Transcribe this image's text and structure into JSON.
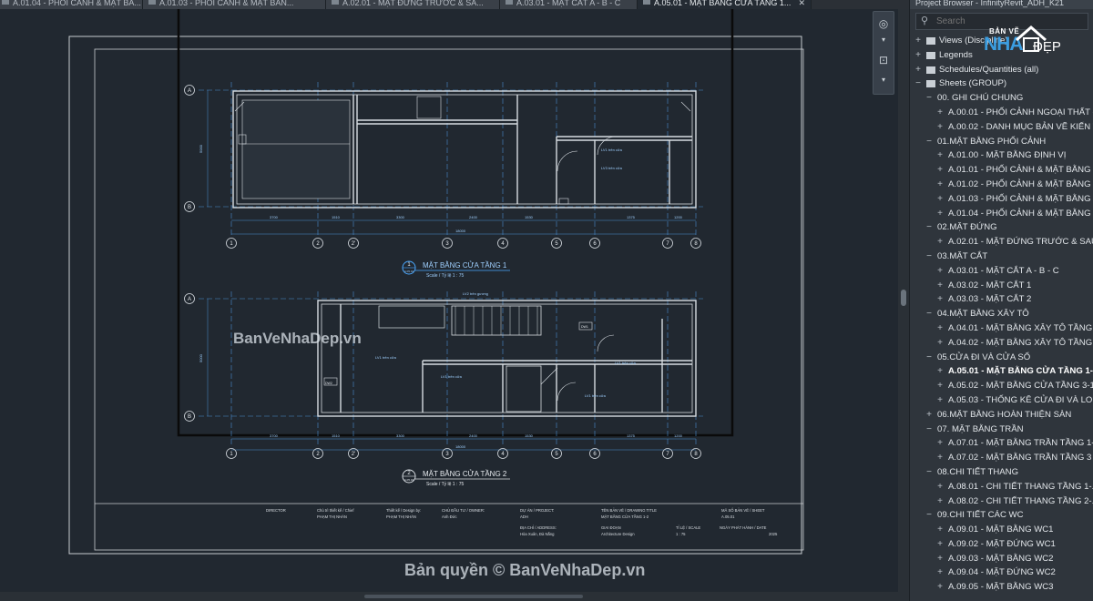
{
  "tabs": [
    {
      "label": "A.01.04 - PHỐI CẢNH & MẶT BẰ...",
      "active": false
    },
    {
      "label": "A.01.03 - PHỐI CẢNH & MẶT BẰN...",
      "active": false
    },
    {
      "label": "A.02.01 - MẶT ĐỨNG TRƯỚC & SA...",
      "active": false
    },
    {
      "label": "A.03.01 - MẶT CẮT A - B - C",
      "active": false
    },
    {
      "label": "A.05.01 - MẶT BẰNG CỬA TẦNG 1...",
      "active": true
    }
  ],
  "tab_close": "✕",
  "project_browser": {
    "title": "Project Browser - InfinityRevit_ADH_K21",
    "search_placeholder": "Search",
    "nodes": [
      {
        "toggle": "+",
        "icon": "views-icon",
        "label": "Views (Discipline)",
        "level": 0
      },
      {
        "toggle": "+",
        "icon": "legends-icon",
        "label": "Legends",
        "level": 0
      },
      {
        "toggle": "+",
        "icon": "schedules-icon",
        "label": "Schedules/Quantities (all)",
        "level": 0
      },
      {
        "toggle": "−",
        "icon": "sheets-icon",
        "label": "Sheets (GROUP)",
        "level": 0
      },
      {
        "toggle": "−",
        "label": "00. GHI CHÚ CHUNG",
        "level": 1
      },
      {
        "toggle": "+",
        "label": "A.00.01 - PHỐI CẢNH NGOẠI THẤT - ...",
        "level": 2
      },
      {
        "toggle": "+",
        "label": "A.00.02 - DANH MỤC BẢN VẼ KIẾN TRÚC",
        "level": 2
      },
      {
        "toggle": "−",
        "label": "01.MẶT BẰNG PHỐI CẢNH",
        "level": 1
      },
      {
        "toggle": "+",
        "label": "A.01.00 - MẶT BẰNG ĐỊNH VỊ",
        "level": 2
      },
      {
        "toggle": "+",
        "label": "A.01.01 - PHỐI CẢNH & MẶT BẰNG ...",
        "level": 2
      },
      {
        "toggle": "+",
        "label": "A.01.02 - PHỐI CẢNH & MẶT BẰNG ...",
        "level": 2
      },
      {
        "toggle": "+",
        "label": "A.01.03 - PHỐI CẢNH & MẶT BẰNG ...",
        "level": 2
      },
      {
        "toggle": "+",
        "label": "A.01.04 - PHỐI CẢNH & MẶT BẰNG ...",
        "level": 2
      },
      {
        "toggle": "−",
        "label": "02.MẶT ĐỨNG",
        "level": 1
      },
      {
        "toggle": "+",
        "label": "A.02.01 - MẶT ĐỨNG TRƯỚC & SAU",
        "level": 2
      },
      {
        "toggle": "−",
        "label": "03.MẶT CẮT",
        "level": 1
      },
      {
        "toggle": "+",
        "label": "A.03.01 - MẶT CẮT A - B - C",
        "level": 2
      },
      {
        "toggle": "+",
        "label": "A.03.02 - MẶT CẮT 1",
        "level": 2
      },
      {
        "toggle": "+",
        "label": "A.03.03 - MẶT CẮT 2",
        "level": 2
      },
      {
        "toggle": "−",
        "label": "04.MẶT BẰNG XÂY TÔ",
        "level": 1
      },
      {
        "toggle": "+",
        "label": "A.04.01 - MẶT BẰNG XÂY TÔ TẦNG ...",
        "level": 2
      },
      {
        "toggle": "+",
        "label": "A.04.02 - MẶT BẰNG XÂY TÔ TẦNG ...",
        "level": 2
      },
      {
        "toggle": "−",
        "label": "05.CỬA ĐI VÀ CỬA SỔ",
        "level": 1
      },
      {
        "toggle": "+",
        "label": "A.05.01 - MẶT BẰNG CỬA TẦNG 1-2",
        "level": 2,
        "selected": true
      },
      {
        "toggle": "+",
        "label": "A.05.02 - MẶT BẰNG CỬA TẦNG 3-1...",
        "level": 2
      },
      {
        "toggle": "+",
        "label": "A.05.03 - THỐNG KÊ CỬA ĐI VÀ LOUVER",
        "level": 2
      },
      {
        "toggle": "+",
        "label": "06.MẶT BẰNG HOÀN THIỆN SÀN",
        "level": 1
      },
      {
        "toggle": "−",
        "label": "07. MẶT BẰNG TRẦN",
        "level": 1
      },
      {
        "toggle": "+",
        "label": "A.07.01 - MẶT BẰNG TRẦN TẦNG 1-...",
        "level": 2
      },
      {
        "toggle": "+",
        "label": "A.07.02 - MẶT BẰNG TRẦN TẦNG 3 ...",
        "level": 2
      },
      {
        "toggle": "−",
        "label": "08.CHI TIẾT THANG",
        "level": 1
      },
      {
        "toggle": "+",
        "label": "A.08.01 - CHI TIẾT THANG TẦNG 1-...",
        "level": 2
      },
      {
        "toggle": "+",
        "label": "A.08.02 - CHI TIẾT THANG TẦNG 2-...",
        "level": 2
      },
      {
        "toggle": "−",
        "label": "09.CHI TIẾT CÁC WC",
        "level": 1
      },
      {
        "toggle": "+",
        "label": "A.09.01 - MẶT BẰNG WC1",
        "level": 2
      },
      {
        "toggle": "+",
        "label": "A.09.02 - MẶT ĐỨNG WC1",
        "level": 2
      },
      {
        "toggle": "+",
        "label": "A.09.03 - MẶT BẰNG WC2",
        "level": 2
      },
      {
        "toggle": "+",
        "label": "A.09.04 - MẶT ĐỨNG WC2",
        "level": 2
      },
      {
        "toggle": "+",
        "label": "A.09.05 - MẶT BẰNG WC3",
        "level": 2
      }
    ]
  },
  "logo": {
    "top": "BẢN VẼ",
    "brand": "NHA",
    "tail": "ĐẸP"
  },
  "watermarks": {
    "side": "BanVeNhaDep.vn",
    "bottom": "Bản quyền © BanVeNhaDep.vn"
  },
  "drawing": {
    "plan1": {
      "title": "MẶT BẰNG CỬA TẦNG 1",
      "number": "1",
      "sheet": "A.05.01",
      "scale": "Scale / Tỷ lệ  1 : 75"
    },
    "plan2": {
      "title": "MẶT BẰNG CỬA TẦNG 2",
      "number": "2",
      "sheet": "A.05.01",
      "scale": "Scale / Tỷ lệ  1 : 75"
    },
    "grid_rows": [
      "A",
      "B"
    ],
    "grid_cols": [
      "1",
      "2",
      "2'",
      "3",
      "4",
      "5",
      "6",
      "7",
      "8"
    ],
    "dims_top": [
      "3700",
      "1510",
      "3300",
      "2400",
      "1530",
      "1375",
      "1200"
    ],
    "overall_dim": "18000",
    "side_dim": "5000",
    "annotations1": [
      "LV1 trên cửa",
      "LV3 trên cửa"
    ],
    "annotations2": [
      "LV2 trên gương",
      "LV1 trên cửa",
      "LV1 trên cửa",
      "LV1 trên cửa",
      "LV1 trên cửa"
    ],
    "door_tags2": [
      "DW1",
      "DW2"
    ],
    "titleblock": {
      "director": "DIRECTOR",
      "chief_label": "Chủ trì thiết kế / Chief",
      "chief_name": "PHẠM THỊ NHÀN",
      "design_label": "Thiết kế / Design by:",
      "design_name": "PHẠM THỊ NHÀN",
      "owner_label": "CHỦ ĐẦU TƯ / OWNER:",
      "owner_name": "Anh Đức",
      "project_label": "DỰ ÁN / PROJECT:",
      "project_name": "ADH",
      "address_label": "ĐỊA CHỈ / ADDRESS:",
      "address_value": "Hòa Xuân, Đà Nẵng",
      "drawing_title_label": "TÊN BẢN VẼ / DRAWING TITLE",
      "drawing_title_value": "MẶT BẰNG CỬA TẦNG 1-2",
      "phase_label": "GIAI ĐOẠN",
      "phase_value": "Architecture Design",
      "scale_label": "TỈ LỆ / SCALE",
      "scale_value": "1 : 75",
      "sheet_label": "MÃ SỐ BẢN VẼ / SHEET",
      "sheet_value": "A.05.01",
      "date_label": "NGÀY PHÁT HÀNH / DATE",
      "date_value": "2025"
    }
  }
}
